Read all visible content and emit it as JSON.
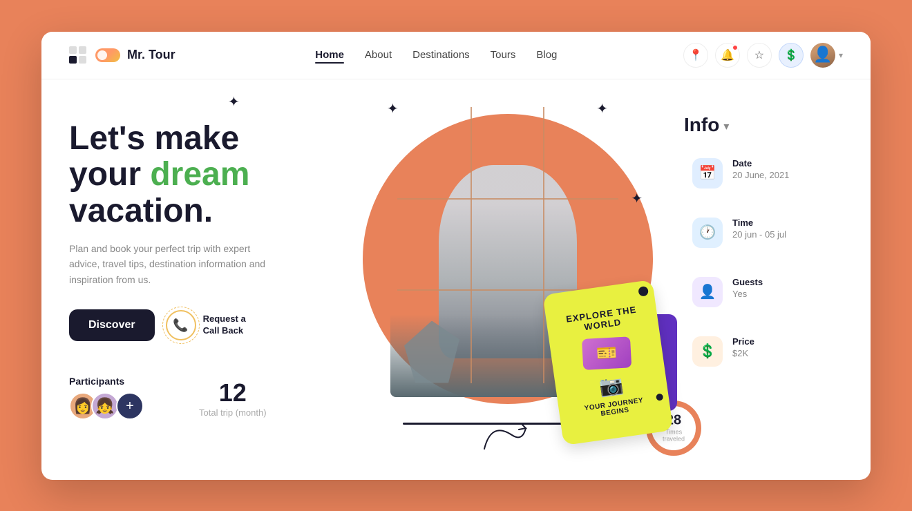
{
  "brand": {
    "name": "Mr. Tour"
  },
  "nav": {
    "links": [
      {
        "id": "home",
        "label": "Home",
        "active": true
      },
      {
        "id": "about",
        "label": "About",
        "active": false
      },
      {
        "id": "destinations",
        "label": "Destinations",
        "active": false
      },
      {
        "id": "tours",
        "label": "Tours",
        "active": false
      },
      {
        "id": "blog",
        "label": "Blog",
        "active": false
      }
    ]
  },
  "hero": {
    "title_line1": "Let's make",
    "title_line2": "your ",
    "title_highlight": "dream",
    "title_line3": "vacation.",
    "subtitle": "Plan and book your perfect trip with expert advice, travel tips, destination information and inspiration from us.",
    "cta_primary": "Discover",
    "cta_secondary_line1": "Request a",
    "cta_secondary_line2": "Call Back"
  },
  "stats": {
    "participants_label": "Participants",
    "total_trip_number": "12",
    "total_trip_label": "Total trip (month)",
    "times_traveled": "28",
    "times_traveled_label": "Times traveled"
  },
  "info": {
    "title": "Info",
    "items": [
      {
        "id": "date",
        "label": "Date",
        "value": "20 June, 2021",
        "icon": "📅",
        "color": "blue"
      },
      {
        "id": "time",
        "label": "Time",
        "value": "20 jun - 05 jul",
        "icon": "🕐",
        "color": "light-blue"
      },
      {
        "id": "guests",
        "label": "Guests",
        "value": "Yes",
        "icon": "👤",
        "color": "purple"
      },
      {
        "id": "price",
        "label": "Price",
        "value": "$2K",
        "icon": "💲",
        "color": "orange"
      }
    ]
  },
  "yellow_card": {
    "title": "EXPLORE THE WORLD",
    "subtitle": "YOUR JOURNEY BEGINS"
  }
}
